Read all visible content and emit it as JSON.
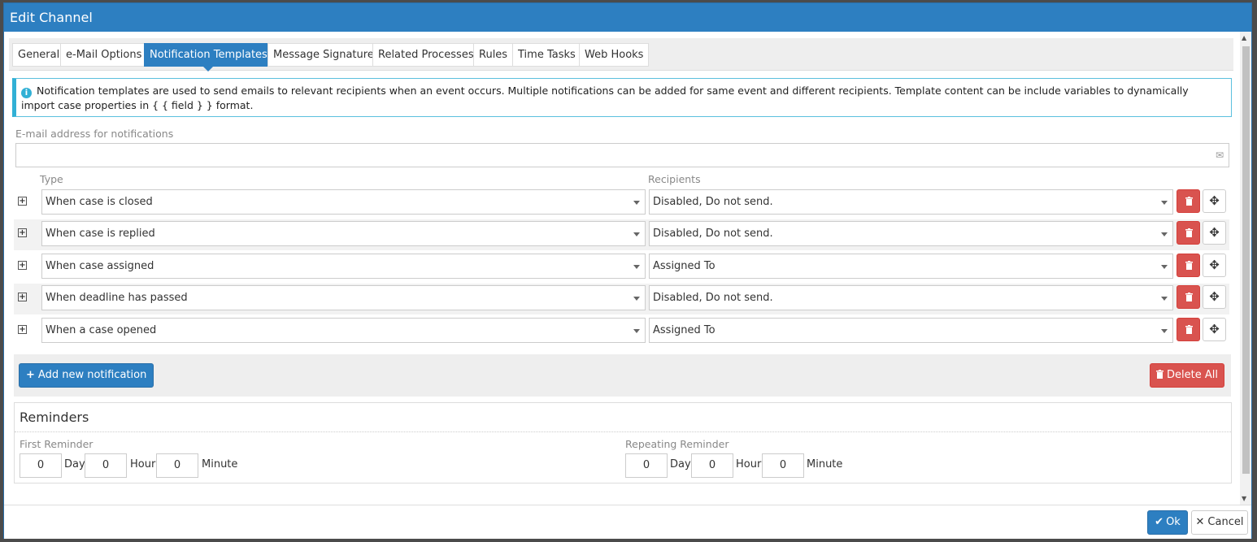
{
  "dialog": {
    "title": "Edit Channel"
  },
  "tabs": [
    {
      "label": "General"
    },
    {
      "label": "e-Mail Options"
    },
    {
      "label": "Notification Templates"
    },
    {
      "label": "Message Signature"
    },
    {
      "label": "Related Processes"
    },
    {
      "label": "Rules"
    },
    {
      "label": "Time Tasks"
    },
    {
      "label": "Web Hooks"
    }
  ],
  "active_tab": "Notification Templates",
  "info": {
    "icon": "info-icon",
    "text": "Notification templates are used to send emails to relevant recipients when an event occurs. Multiple notifications can be added for same event and different recipients. Template content can be include variables to dynamically import case properties in { { field } } format."
  },
  "email": {
    "label": "E-mail address for notifications",
    "value": "",
    "icon": "envelope-icon"
  },
  "columns": {
    "type": "Type",
    "recipients": "Recipients"
  },
  "notifications": [
    {
      "type": "When case is closed",
      "recipients": "Disabled, Do not send."
    },
    {
      "type": "When case is replied",
      "recipients": "Disabled, Do not send."
    },
    {
      "type": "When case assigned",
      "recipients": "Assigned To"
    },
    {
      "type": "When deadline has passed",
      "recipients": "Disabled, Do not send."
    },
    {
      "type": "When a case opened",
      "recipients": "Assigned To"
    }
  ],
  "actions": {
    "add_label": "Add new notification",
    "delete_all_label": "Delete All"
  },
  "reminders": {
    "title": "Reminders",
    "first": {
      "label": "First Reminder",
      "day": "0",
      "hour": "0",
      "minute": "0"
    },
    "repeating": {
      "label": "Repeating Reminder",
      "day": "0",
      "hour": "0",
      "minute": "0"
    },
    "units": {
      "day": "Day",
      "hour": "Hour",
      "minute": "Minute"
    }
  },
  "footer": {
    "ok_label": "Ok",
    "cancel_label": "Cancel"
  },
  "colors": {
    "primary": "#2d7fc1",
    "danger": "#d9534f",
    "info_border": "#5bc0de"
  }
}
